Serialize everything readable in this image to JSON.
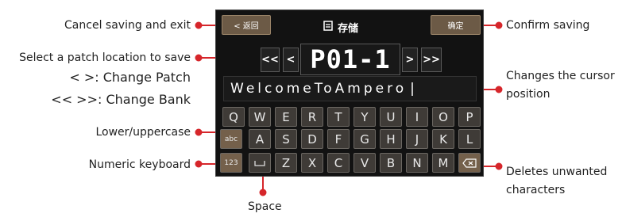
{
  "callouts": {
    "cancel": "Cancel saving and exit",
    "select_location": "Select a patch location to save",
    "change_patch": "< >: Change Patch",
    "change_bank": "<< >>: Change Bank",
    "lower_upper": "Lower/uppercase",
    "numeric": "Numeric keyboard",
    "space": "Space",
    "confirm": "Confirm saving",
    "cursor_1": "Changes the cursor",
    "cursor_2": "position",
    "delete_1": "Deletes unwanted",
    "delete_2": "characters"
  },
  "device": {
    "back_label": "< 返回",
    "title": "存储",
    "confirm_label": "确定",
    "nav": {
      "bank_prev": "<<",
      "patch_prev": "<",
      "patch_next": ">",
      "bank_next": ">>"
    },
    "patch": "P01-1",
    "text_value": "WelcomeToAmpero",
    "cursor": "|",
    "keys_row1": [
      "Q",
      "W",
      "E",
      "R",
      "T",
      "Y",
      "U",
      "I",
      "O",
      "P"
    ],
    "keys_row2": [
      "A",
      "S",
      "D",
      "F",
      "G",
      "H",
      "J",
      "K",
      "L"
    ],
    "keys_row3": [
      "Z",
      "X",
      "C",
      "V",
      "B",
      "N",
      "M"
    ],
    "abc_label": "abc",
    "num_label": "123"
  },
  "colors": {
    "callout_line": "#d6262b",
    "button_brown": "#6c5a46"
  }
}
